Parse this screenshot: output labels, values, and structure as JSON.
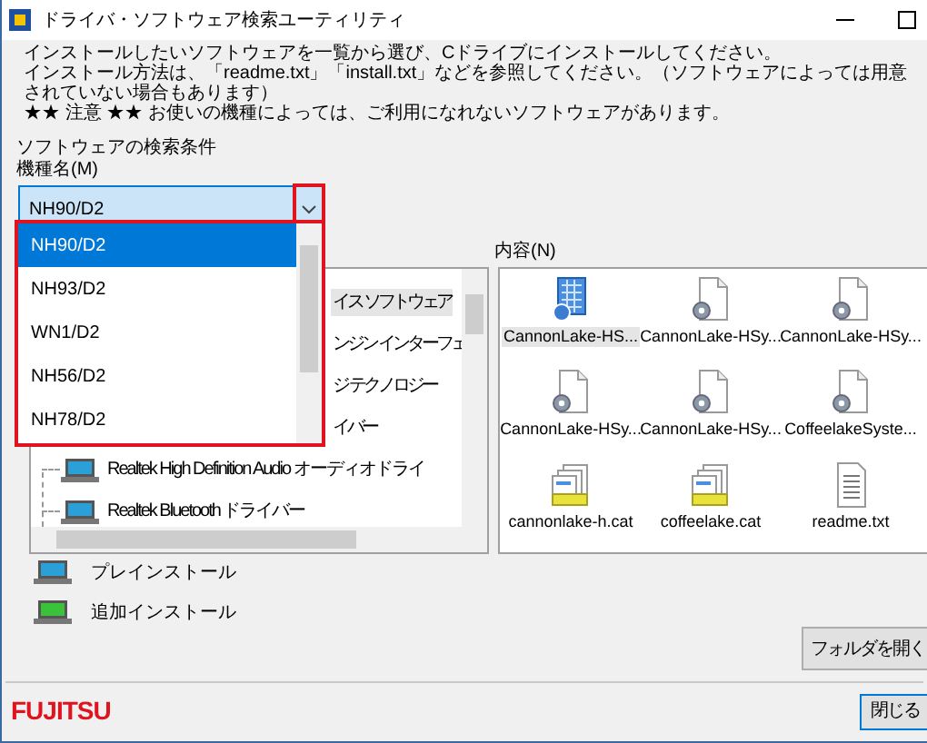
{
  "window": {
    "title": "ドライバ・ソフトウェア検索ユーティリティ"
  },
  "instructions": [
    "インストールしたいソフトウェアを一覧から選び、Cドライブにインストールしてください。",
    "インストール方法は、「readme.txt」「install.txt」などを参照してください。（ソフトウェアによっては用意されていない場合もあります）",
    "★★ 注意 ★★ お使いの機種によっては、ご利用になれないソフトウェアがあります。"
  ],
  "search_label": "ソフトウェアの検索条件",
  "model_label": "機種名(M)",
  "model_combo": {
    "value": "NH90/D2",
    "expanded": true,
    "options": [
      {
        "label": "NH90/D2",
        "selected": true
      },
      {
        "label": "NH93/D2",
        "selected": false
      },
      {
        "label": "WN1/D2",
        "selected": false
      },
      {
        "label": "NH56/D2",
        "selected": false
      },
      {
        "label": "NH78/D2",
        "selected": false
      }
    ]
  },
  "tree": {
    "rows": [
      {
        "text": "イス ソフトウェア",
        "kind": "fragment",
        "selected": true
      },
      {
        "text": "ンジン インターフェ",
        "kind": "fragment",
        "selected": false
      },
      {
        "text": "ジ テクノロジー",
        "kind": "fragment",
        "selected": false
      },
      {
        "text": "イバー",
        "kind": "fragment",
        "selected": false
      },
      {
        "text": "Realtek High Definition Audio オーディオドライ",
        "kind": "item",
        "selected": false
      },
      {
        "text": "Realtek Bluetooth ドライバー",
        "kind": "item",
        "selected": false
      }
    ]
  },
  "content": {
    "label": "内容(N)",
    "items": [
      {
        "name": "CannonLake-HS...",
        "kind": "setup",
        "selected": true
      },
      {
        "name": "CannonLake-HSy...",
        "kind": "config",
        "selected": false
      },
      {
        "name": "CannonLake-HSy...",
        "kind": "config",
        "selected": false
      },
      {
        "name": "CannonLake-HSy...",
        "kind": "config",
        "selected": false
      },
      {
        "name": "CannonLake-HSy...",
        "kind": "config",
        "selected": false
      },
      {
        "name": "CoffeelakeSyste...",
        "kind": "config",
        "selected": false
      },
      {
        "name": "cannonlake-h.cat",
        "kind": "catalog",
        "selected": false
      },
      {
        "name": "coffeelake.cat",
        "kind": "catalog",
        "selected": false
      },
      {
        "name": "readme.txt",
        "kind": "text",
        "selected": false
      }
    ]
  },
  "legend": [
    {
      "label": "プレインストール",
      "kind": "preinstall"
    },
    {
      "label": "追加インストール",
      "kind": "additional"
    }
  ],
  "open_folder_button": "フォルダを開く",
  "logo": "FUJITSU",
  "close_button": "閉じる"
}
